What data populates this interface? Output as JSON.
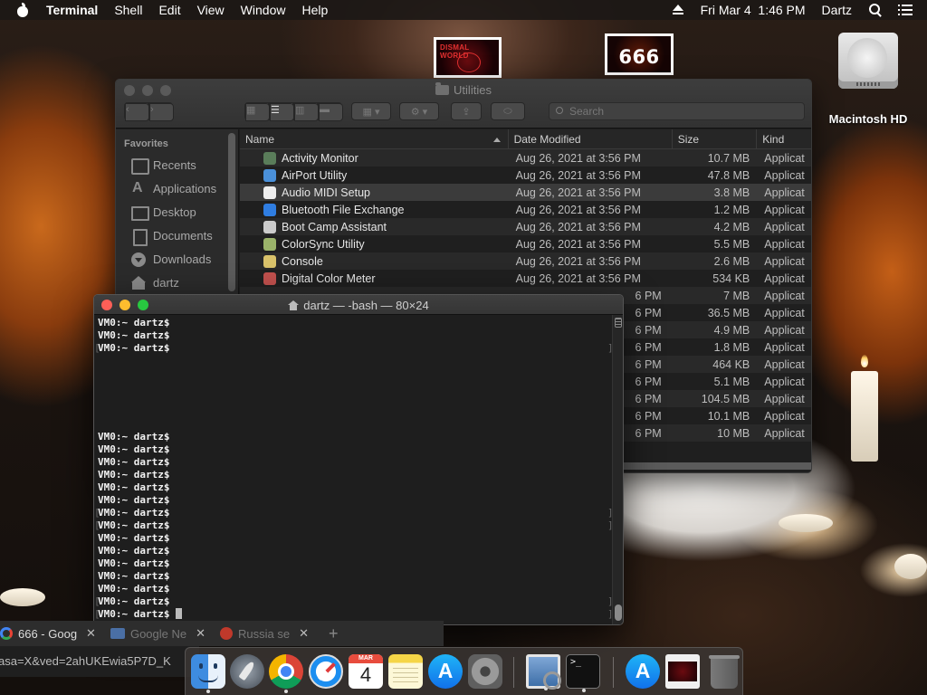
{
  "menubar": {
    "app_name": "Terminal",
    "items": [
      "Shell",
      "Edit",
      "View",
      "Window",
      "Help"
    ],
    "clock": "Fri Mar 4  1:46 PM",
    "user": "Dartz"
  },
  "desktop": {
    "thumbnail_1_text": "DISMAL WORLD",
    "thumbnail_2_text": "666",
    "drive_label": "Macintosh HD"
  },
  "finder": {
    "title": "Utilities",
    "search_placeholder": "Search",
    "sidebar": {
      "heading": "Favorites",
      "items": [
        {
          "label": "Recents",
          "icon": "clock-icon"
        },
        {
          "label": "Applications",
          "icon": "applications-icon"
        },
        {
          "label": "Desktop",
          "icon": "desktop-icon"
        },
        {
          "label": "Documents",
          "icon": "documents-icon"
        },
        {
          "label": "Downloads",
          "icon": "downloads-icon"
        },
        {
          "label": "dartz",
          "icon": "home-icon"
        }
      ]
    },
    "columns": {
      "name": "Name",
      "date": "Date Modified",
      "size": "Size",
      "kind": "Kind"
    },
    "rows": [
      {
        "name": "Activity Monitor",
        "date": "Aug 26, 2021 at 3:56 PM",
        "size": "10.7 MB",
        "kind": "Applicat",
        "color": "#5a7d5a"
      },
      {
        "name": "AirPort Utility",
        "date": "Aug 26, 2021 at 3:56 PM",
        "size": "47.8 MB",
        "kind": "Applicat",
        "color": "#4a90d9"
      },
      {
        "name": "Audio MIDI Setup",
        "date": "Aug 26, 2021 at 3:56 PM",
        "size": "3.8 MB",
        "kind": "Applicat",
        "color": "#eeeeee"
      },
      {
        "name": "Bluetooth File Exchange",
        "date": "Aug 26, 2021 at 3:56 PM",
        "size": "1.2 MB",
        "kind": "Applicat",
        "color": "#2f7de1"
      },
      {
        "name": "Boot Camp Assistant",
        "date": "Aug 26, 2021 at 3:56 PM",
        "size": "4.2 MB",
        "kind": "Applicat",
        "color": "#cccccc"
      },
      {
        "name": "ColorSync Utility",
        "date": "Aug 26, 2021 at 3:56 PM",
        "size": "5.5 MB",
        "kind": "Applicat",
        "color": "#9ab36a"
      },
      {
        "name": "Console",
        "date": "Aug 26, 2021 at 3:56 PM",
        "size": "2.6 MB",
        "kind": "Applicat",
        "color": "#d9c26a"
      },
      {
        "name": "Digital Color Meter",
        "date": "Aug 26, 2021 at 3:56 PM",
        "size": "534 KB",
        "kind": "Applicat",
        "color": "#c0504d"
      },
      {
        "name": "",
        "date": "6 PM",
        "size": "7 MB",
        "kind": "Applicat",
        "color": ""
      },
      {
        "name": "",
        "date": "6 PM",
        "size": "36.5 MB",
        "kind": "Applicat",
        "color": ""
      },
      {
        "name": "",
        "date": "6 PM",
        "size": "4.9 MB",
        "kind": "Applicat",
        "color": ""
      },
      {
        "name": "",
        "date": "6 PM",
        "size": "1.8 MB",
        "kind": "Applicat",
        "color": ""
      },
      {
        "name": "",
        "date": "6 PM",
        "size": "464 KB",
        "kind": "Applicat",
        "color": ""
      },
      {
        "name": "",
        "date": "6 PM",
        "size": "5.1 MB",
        "kind": "Applicat",
        "color": ""
      },
      {
        "name": "",
        "date": "6 PM",
        "size": "104.5 MB",
        "kind": "Applicat",
        "color": ""
      },
      {
        "name": "",
        "date": "6 PM",
        "size": "10.1 MB",
        "kind": "Applicat",
        "color": ""
      },
      {
        "name": "",
        "date": "6 PM",
        "size": "10 MB",
        "kind": "Applicat",
        "color": ""
      }
    ]
  },
  "terminal": {
    "title": "dartz — -bash — 80×24",
    "prompt": "VM0:~ dartz$",
    "top_lines": 3,
    "bottom_lines": 15
  },
  "chrome": {
    "tabs": [
      {
        "label": "666 - Goog",
        "icon": "google-icon"
      },
      {
        "label": "Google Ne",
        "icon": "news-icon"
      },
      {
        "label": "Russia se",
        "icon": "russia-site-icon"
      }
    ],
    "new_tab": "+",
    "url": "asa=X&ved=2ahUKEwia5P7D_K"
  },
  "dock": {
    "calendar_month": "MAR",
    "calendar_day": "4"
  }
}
